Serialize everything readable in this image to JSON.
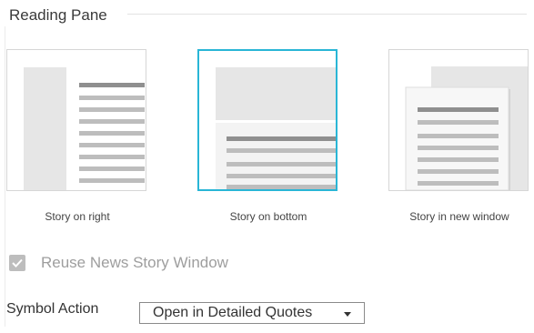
{
  "section": {
    "title": "Reading Pane"
  },
  "layouts": [
    {
      "label": "Story on right",
      "selected": false
    },
    {
      "label": "Story on bottom",
      "selected": true
    },
    {
      "label": "Story in new window",
      "selected": false
    }
  ],
  "reuse_window": {
    "label": "Reuse News Story Window",
    "checked": true,
    "disabled": true
  },
  "symbol_action": {
    "label": "Symbol Action",
    "value": "Open in Detailed Quotes"
  },
  "colors": {
    "selected_border": "#29b6d6",
    "thumb_fill": "#e6e6e6",
    "thumb_line_dark": "#8f8f8f",
    "thumb_line_light": "#bdbdbd"
  },
  "icons": {
    "check": "checkmark-icon",
    "dropdown": "caret-down-icon"
  }
}
